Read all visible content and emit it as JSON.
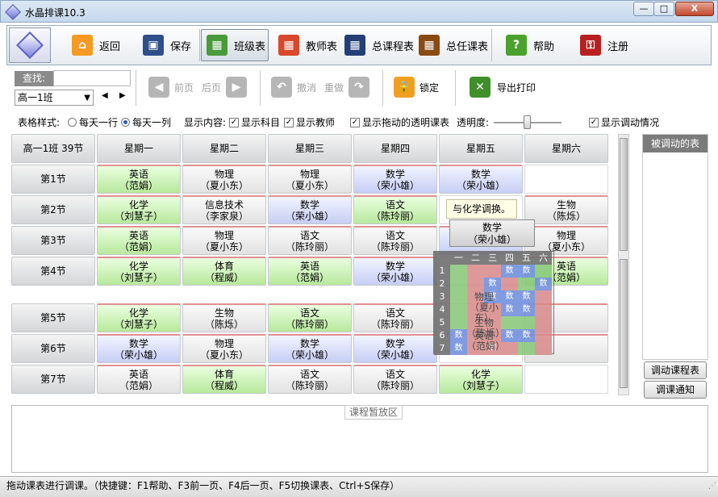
{
  "window": {
    "title": "水晶排课10.3",
    "min": "—",
    "max": "□",
    "close": "X"
  },
  "toolbar": {
    "back": "返回",
    "save": "保存",
    "class_table": "班级表",
    "teacher_table": "教师表",
    "total_course": "总课程表",
    "total_duty": "总任课表",
    "help": "帮助",
    "register": "注册"
  },
  "controls": {
    "search_label": "查找:",
    "search_value": "",
    "class_select": "高一1班",
    "prev_page": "前页",
    "next_page": "后页",
    "undo": "撤消",
    "redo": "重做",
    "lock": "锁定",
    "export_print": "导出打印"
  },
  "options": {
    "style_label": "表格样式:",
    "per_row": "每天一行",
    "per_col": "每天一列",
    "content_label": "显示内容:",
    "show_subject": "显示科目",
    "show_teacher": "显示教师",
    "show_drag_transparent": "显示拖动的透明课表",
    "opacity_label": "透明度:",
    "show_adjust": "显示调动情况",
    "check": "✓"
  },
  "grid": {
    "corner": "高一1班 39节",
    "days": [
      "星期一",
      "星期二",
      "星期三",
      "星期四",
      "星期五",
      "星期六"
    ],
    "periods": [
      "第1节",
      "第2节",
      "第3节",
      "第4节",
      "第5节",
      "第6节",
      "第7节"
    ],
    "rows": [
      [
        {
          "s": "英语",
          "t": "（范娟）",
          "c": "green"
        },
        {
          "s": "物理",
          "t": "（夏小东）",
          "c": "gray"
        },
        {
          "s": "物理",
          "t": "（夏小东）",
          "c": "gray"
        },
        {
          "s": "数学",
          "t": "（荣小雄）",
          "c": "blue"
        },
        {
          "s": "数学",
          "t": "（荣小雄）",
          "c": "blue"
        },
        {
          "s": "",
          "t": "",
          "c": "empty"
        }
      ],
      [
        {
          "s": "化学",
          "t": "（刘慧子）",
          "c": "green"
        },
        {
          "s": "信息技术",
          "t": "（李家泉）",
          "c": "gray"
        },
        {
          "s": "数学",
          "t": "（荣小雄）",
          "c": "blue"
        },
        {
          "s": "语文",
          "t": "（陈玲丽）",
          "c": "green"
        },
        {
          "s": "",
          "t": "",
          "c": "empty"
        },
        {
          "s": "生物",
          "t": "（陈烁）",
          "c": "gray"
        }
      ],
      [
        {
          "s": "英语",
          "t": "（范娟）",
          "c": "green"
        },
        {
          "s": "物理",
          "t": "（夏小东）",
          "c": "gray"
        },
        {
          "s": "语文",
          "t": "（陈玲丽）",
          "c": "gray"
        },
        {
          "s": "语文",
          "t": "（陈玲丽）",
          "c": "gray"
        },
        {
          "s": "",
          "t": "",
          "c": "blue"
        },
        {
          "s": "物理",
          "t": "（夏小东）",
          "c": "gray"
        }
      ],
      [
        {
          "s": "化学",
          "t": "（刘慧子）",
          "c": "green"
        },
        {
          "s": "体育",
          "t": "（程威）",
          "c": "green"
        },
        {
          "s": "英语",
          "t": "（范娟）",
          "c": "green"
        },
        {
          "s": "数学",
          "t": "（荣小雄）",
          "c": "blue"
        },
        {
          "s": "",
          "t": "",
          "c": "empty"
        },
        {
          "s": "英语",
          "t": "（范娟）",
          "c": "green"
        }
      ],
      [
        {
          "s": "化学",
          "t": "（刘慧子）",
          "c": "green"
        },
        {
          "s": "生物",
          "t": "（陈烁）",
          "c": "gray"
        },
        {
          "s": "语文",
          "t": "（陈玲丽）",
          "c": "green"
        },
        {
          "s": "语文",
          "t": "（陈玲丽）",
          "c": "gray"
        },
        {
          "s": "",
          "t": "",
          "c": "empty"
        },
        {
          "s": "",
          "t": "",
          "c": "gray"
        }
      ],
      [
        {
          "s": "数学",
          "t": "（荣小雄）",
          "c": "blue"
        },
        {
          "s": "物理",
          "t": "（夏小东）",
          "c": "gray"
        },
        {
          "s": "数学",
          "t": "（荣小雄）",
          "c": "blue"
        },
        {
          "s": "数学",
          "t": "（荣小雄）",
          "c": "blue"
        },
        {
          "s": "",
          "t": "",
          "c": "empty"
        },
        {
          "s": "",
          "t": "",
          "c": "gray"
        }
      ],
      [
        {
          "s": "英语",
          "t": "（范娟）",
          "c": "gray"
        },
        {
          "s": "体育",
          "t": "（程威）",
          "c": "green"
        },
        {
          "s": "语文",
          "t": "（陈玲丽）",
          "c": "gray"
        },
        {
          "s": "语文",
          "t": "（陈玲丽）",
          "c": "gray"
        },
        {
          "s": "化学",
          "t": "（刘慧子）",
          "c": "green"
        },
        {
          "s": "",
          "t": "",
          "c": "empty"
        }
      ]
    ]
  },
  "drag": {
    "tip": "与化学调换。",
    "card_subject": "数学",
    "card_teacher": "（荣小雄）",
    "mini_header": [
      "一",
      "二",
      "三",
      "四",
      "五",
      "六"
    ],
    "mini_rows": [
      "1",
      "2",
      "3",
      "4",
      "5",
      "6",
      "7"
    ],
    "mini_label": "数",
    "mini_behind": [
      {
        "s": "物理",
        "t": "（夏小东）",
        "row": 3
      },
      {
        "s": "生物",
        "t": "（陈烁）",
        "row": 5
      },
      {
        "s": "英语",
        "t": "（范娟）",
        "row": 6
      }
    ]
  },
  "side": {
    "header": "被调动的表",
    "adjust_table": "调动课程表",
    "adjust_notice": "调课通知"
  },
  "stash": {
    "label": "课程暂放区"
  },
  "status": {
    "text": "拖动课表进行调课。（快捷键：F1帮助、F3前一页、F4后一页、F5切换课表、Ctrl+S保存）"
  }
}
